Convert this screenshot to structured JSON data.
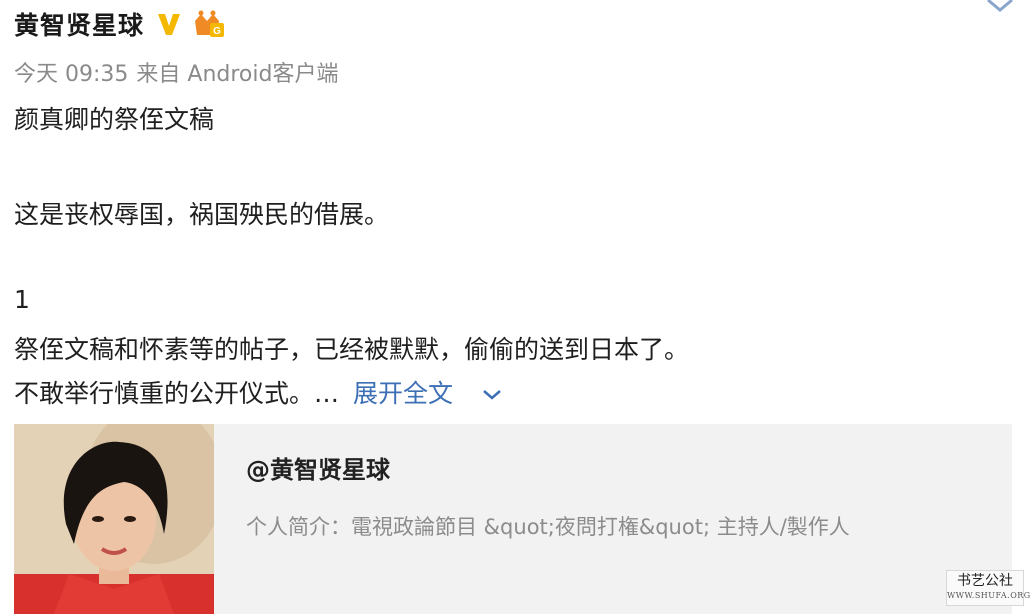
{
  "header": {
    "username": "黄智贤星球"
  },
  "meta": {
    "time": "今天 09:35",
    "source": "来自 Android客户端"
  },
  "post": {
    "lines": [
      "颜真卿的祭侄文稿",
      "这是丧权辱国，祸国殃民的借展。",
      "1",
      "祭侄文稿和怀素等的帖子，已经被默默，偷偷的送到日本了。",
      "不敢举行慎重的公开仪式。…"
    ],
    "expand_label": "展开全文"
  },
  "card": {
    "title": "@黄智贤星球",
    "description": "个人简介：電視政論節目 &quot;夜問打権&quot; 主持人/製作人"
  },
  "watermark": {
    "text": "书艺公社",
    "site": "WWW.SHUFA.ORG"
  },
  "colors": {
    "link": "#3d6fb5",
    "verified": "#f5b800",
    "card_bg": "#f2f2f2"
  }
}
